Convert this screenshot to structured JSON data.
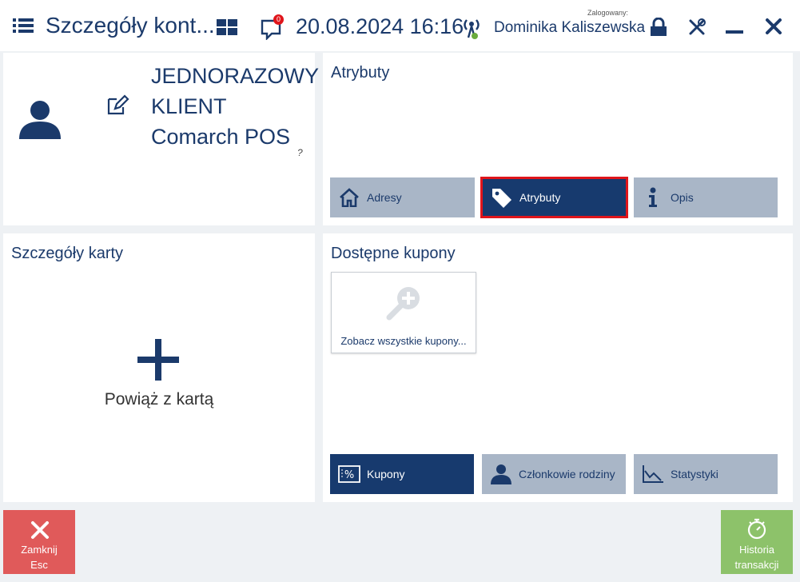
{
  "header": {
    "title": "Szczegóły kont...",
    "datetime": "20.08.2024 16:16",
    "logged_label": "Zalogowany:",
    "username": "Dominika Kaliszewska",
    "notifications_count": "0",
    "colors": {
      "brand": "#1b3a6b",
      "badge": "#e0151b"
    }
  },
  "customer": {
    "name_line1": "JEDNORAZOWY",
    "name_line2": "KLIENT",
    "name_line3": "Comarch POS",
    "question_mark": "?"
  },
  "attributes_panel": {
    "title": "Atrybuty",
    "tabs": [
      {
        "label": "Adresy",
        "icon": "home-icon",
        "active": false
      },
      {
        "label": "Atrybuty",
        "icon": "tag-icon",
        "active": true
      },
      {
        "label": "Opis",
        "icon": "info-icon",
        "active": false
      }
    ]
  },
  "card_panel": {
    "title": "Szczegóły karty",
    "bind_label": "Powiąż z kartą"
  },
  "coupons_panel": {
    "title": "Dostępne kupony",
    "see_all_label": "Zobacz wszystkie kupony...",
    "tabs": [
      {
        "label": "Kupony",
        "icon": "percent-icon",
        "active": true
      },
      {
        "label": "Członkowie rodziny",
        "icon": "person-icon",
        "active": false
      },
      {
        "label": "Statystyki",
        "icon": "chart-icon",
        "active": false
      }
    ]
  },
  "footer": {
    "close_label_1": "Zamknij",
    "close_label_2": "Esc",
    "history_label_1": "Historia",
    "history_label_2": "transakcji",
    "colors": {
      "close": "#e05a5a",
      "history": "#8dc26a"
    }
  }
}
